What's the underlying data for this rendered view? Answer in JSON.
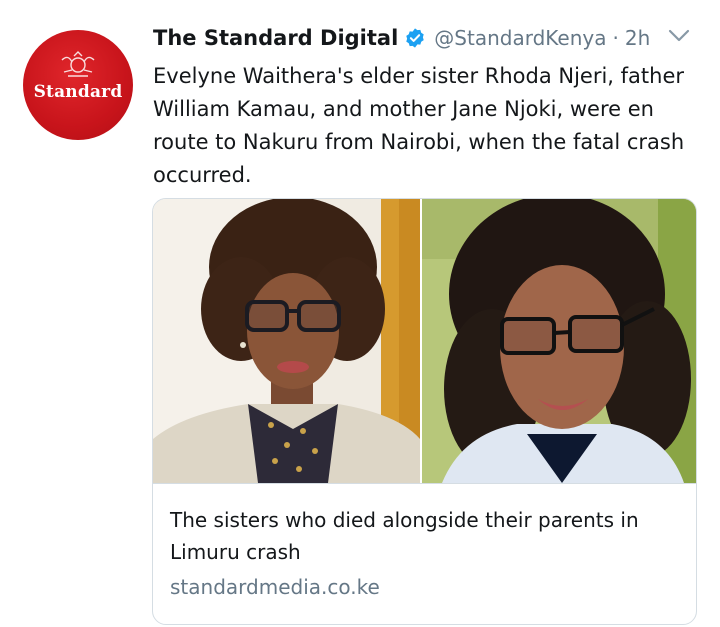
{
  "account": {
    "display_name": "The Standard Digital",
    "handle": "@StandardKenya",
    "separator": "·",
    "timestamp": "2h",
    "avatar_text": "Standard",
    "verified": true
  },
  "tweet": {
    "text": "Evelyne Waithera's elder sister Rhoda Njeri, father William Kamau, and mother Jane Njoki, were en route to Nakuru from Nairobi, when the fatal crash occurred."
  },
  "card": {
    "title": "The sisters who died alongside their parents in Limuru crash",
    "domain": "standardmedia.co.ke"
  },
  "icons": {
    "verified": "verified-badge-icon",
    "menu": "chevron-down-icon"
  },
  "colors": {
    "avatar_red": "#d31a20",
    "verified_blue": "#1da1f2",
    "secondary_text": "#657786"
  }
}
